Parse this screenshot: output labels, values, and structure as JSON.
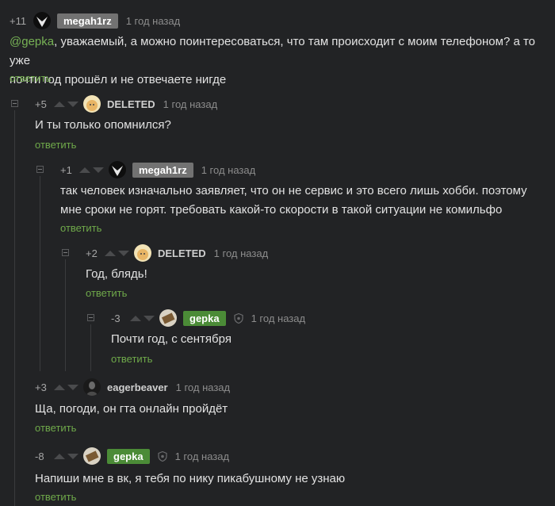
{
  "comments": [
    {
      "rating": "+11",
      "nick": "megah1rz",
      "time": "1 год назад",
      "mention": "@gepka",
      "text_line1": ", уважаемый, а можно поинтересоваться, что там происходит с моим телефоном? а то уже",
      "text_line2": "почти год прошёл и не отвечаете нигде",
      "reply": "ответить"
    },
    {
      "rating": "+5",
      "nick": "DELETED",
      "time": "1 год назад",
      "text": "И ты только опомнился?",
      "reply": "ответить"
    },
    {
      "rating": "+1",
      "nick": "megah1rz",
      "time": "1 год назад",
      "text_line1": "так человек изначально заявляет, что он не сервис и это всего лишь хобби. поэтому",
      "text_line2": "мне сроки не горят. требовать какой-то скорости в такой ситуации не комильфо",
      "reply": "ответить"
    },
    {
      "rating": "+2",
      "nick": "DELETED",
      "time": "1 год назад",
      "text": "Год, блядь!",
      "reply": "ответить"
    },
    {
      "rating": "-3",
      "nick": "gepka",
      "time": "1 год назад",
      "text": "Почти год, с сентября",
      "reply": "ответить"
    },
    {
      "rating": "+3",
      "nick": "eagerbeaver",
      "time": "1 год назад",
      "text": "Ща, погоди, он гта онлайн пройдёт",
      "reply": "ответить"
    },
    {
      "rating": "-8",
      "nick": "gepka",
      "time": "1 год назад",
      "text": "Напиши мне в вк,  я тебя по нику пикабушному не узнаю",
      "reply": "ответить"
    }
  ],
  "icons": {
    "vote_up": "triangle-up-icon",
    "vote_down": "triangle-down-icon",
    "collapse": "collapse-minus-icon",
    "author_badge": "shield-icon"
  },
  "colors": {
    "background": "#222325",
    "reply_link": "#6fa94a",
    "op_badge": "#727272",
    "author_badge": "#4b8b37"
  }
}
